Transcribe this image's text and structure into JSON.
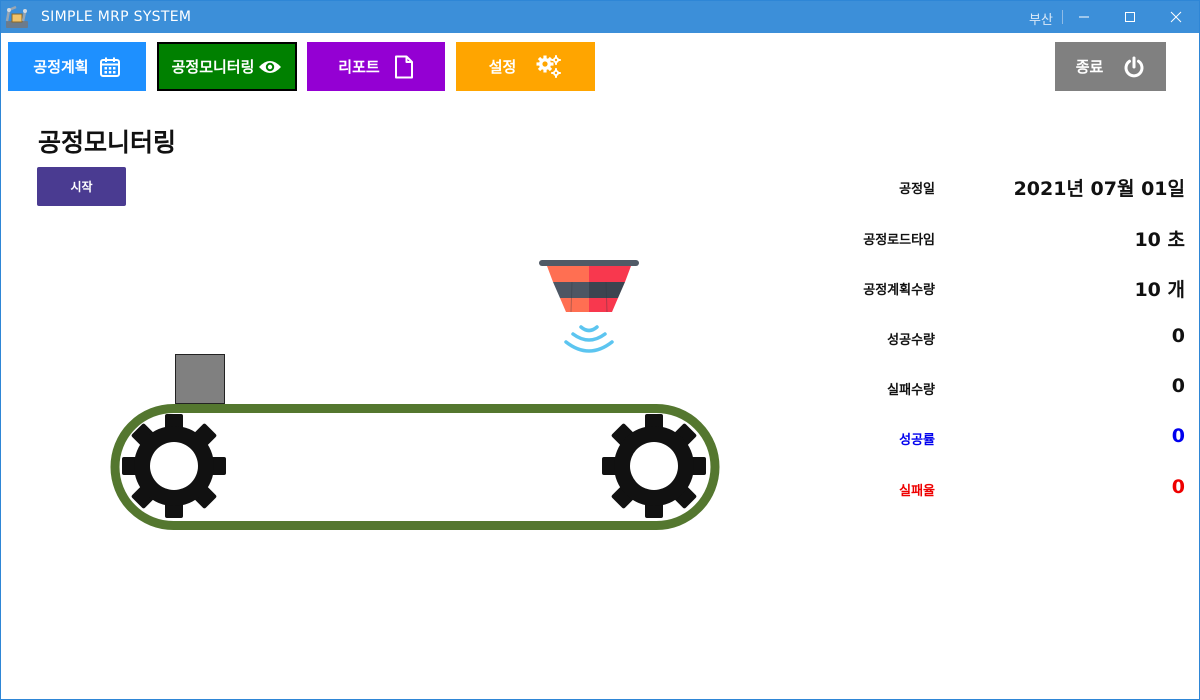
{
  "window": {
    "title": "SIMPLE MRP SYSTEM",
    "user": "부산"
  },
  "nav": {
    "plan": "공정계획",
    "monitor": "공정모니터링",
    "report": "리포트",
    "settings": "설정",
    "exit": "종료"
  },
  "page": {
    "title": "공정모니터링",
    "start_button": "시작"
  },
  "stats": [
    {
      "label": "공정일",
      "value": "2021년 07월 01일"
    },
    {
      "label": "공정로드타임",
      "value": "10 초"
    },
    {
      "label": "공정계획수량",
      "value": "10 개"
    },
    {
      "label": "성공수량",
      "value": "0"
    },
    {
      "label": "실패수량",
      "value": "0"
    },
    {
      "label": "성공률",
      "value": "0"
    },
    {
      "label": "실패율",
      "value": "0"
    }
  ],
  "colors": {
    "titlebar": "#3c8fd9",
    "plan_button": "#1e90ff",
    "monitor_button": "#008000",
    "report_button": "#9400d3",
    "settings_button": "#ffa500",
    "exit_button": "#808080",
    "start_button": "#4a3b91",
    "success_rate": "#0000ee",
    "failure_rate": "#ee0000",
    "belt": "#54772f",
    "product": "#808080"
  },
  "icons": {
    "plan": "calendar-icon",
    "monitor": "eye-icon",
    "report": "file-icon",
    "settings": "gears-icon",
    "exit": "power-icon",
    "sensor": "sensor-funnel-icon",
    "gear": "gear-icon"
  }
}
